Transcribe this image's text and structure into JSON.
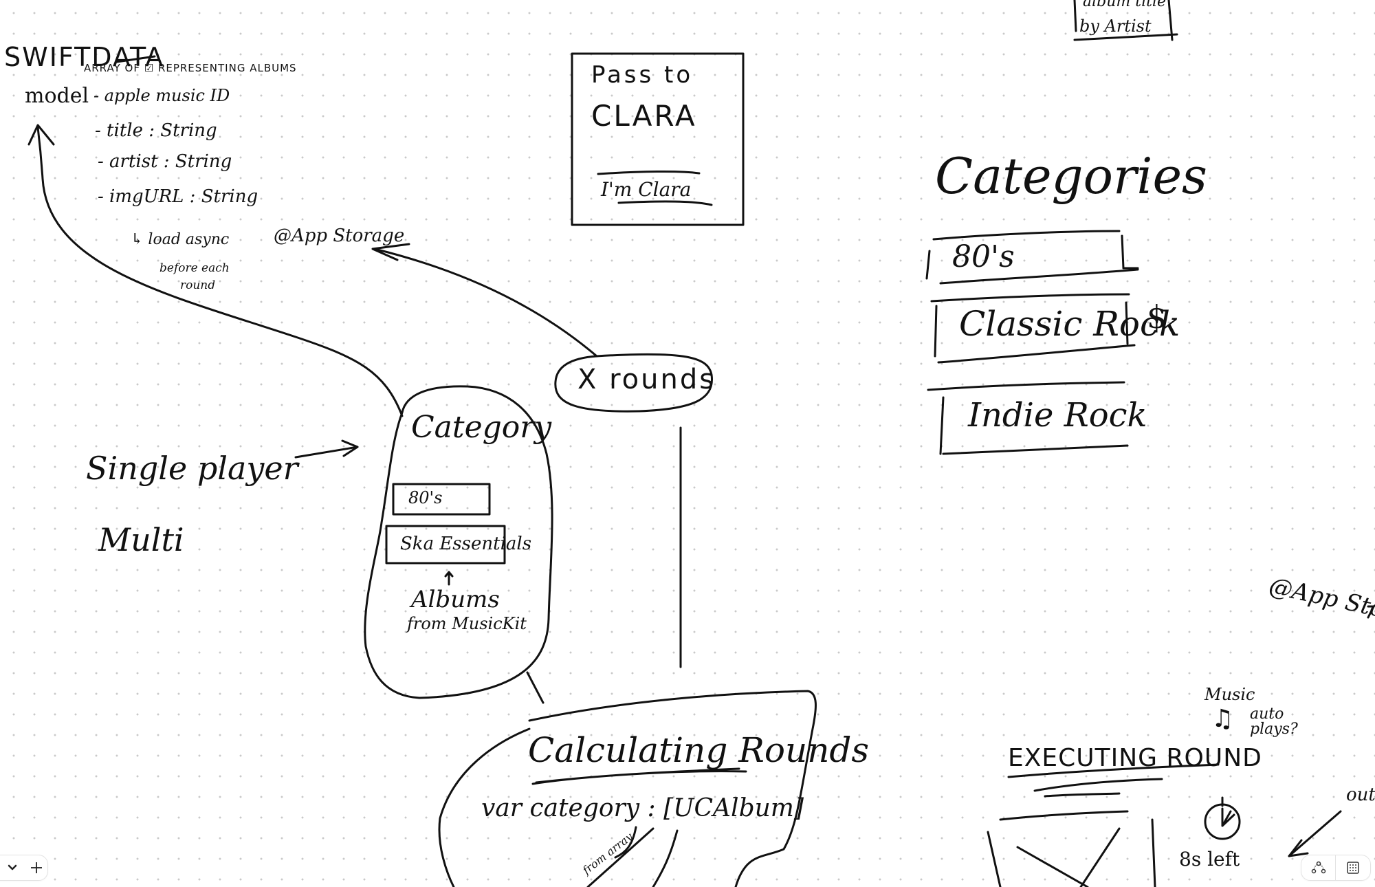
{
  "canvas": {
    "background": "#ffffff",
    "grid_dot_color": "#c9c9c9",
    "ink_color": "#111111"
  },
  "notes": {
    "swiftdata": {
      "title": "SWIFTDATA",
      "subtitle": "ARRAY OF ☑ REPRESENTING ALBUMS",
      "model_label": "model",
      "fields": [
        "- apple music ID",
        "- title : String",
        "- artist : String",
        "- imgURL : String"
      ],
      "load_note_line1": "↳ load async",
      "load_note_line2": "before each",
      "load_note_line3": "round"
    },
    "app_storage_left": "@App Storage",
    "app_storage_right": "@App Storage",
    "pass_card": {
      "line1": "Pass to",
      "line2": "CLARA",
      "button": "I'm Clara"
    },
    "top_right_card": {
      "line1": "album title",
      "line2": "by Artist"
    },
    "categories_panel": {
      "title": "Categories",
      "items": [
        "80's",
        "Classic Rock",
        "Indie Rock"
      ],
      "price_marker": "$"
    },
    "rounds_bubble": "X rounds",
    "player_modes": {
      "single": "Single player",
      "multi": "Multi"
    },
    "category_blob": {
      "title": "Category",
      "items": [
        "80's",
        "Ska Essentials"
      ],
      "caption_line1": "Albums",
      "caption_line2": "from MusicKit"
    },
    "calculating_rounds": {
      "title": "Calculating Rounds",
      "code": "var category : [UCAlbum]",
      "annotation": "from array"
    },
    "executing_round": {
      "title": "EXECUTING ROUND",
      "music_label": "Music",
      "music_icon": "music-notes-icon",
      "auto_plays": "auto plays?",
      "timer_icon": "stopwatch-icon",
      "time_left": "8s left",
      "cut_off_label": "out"
    }
  },
  "toolbar_left": {
    "chevron_icon": "chevron-down-icon",
    "add_icon": "plus-icon"
  },
  "toolbar_right": {
    "connector_icon": "connector-nodes-icon",
    "grid_icon": "grid-toggle-icon"
  }
}
